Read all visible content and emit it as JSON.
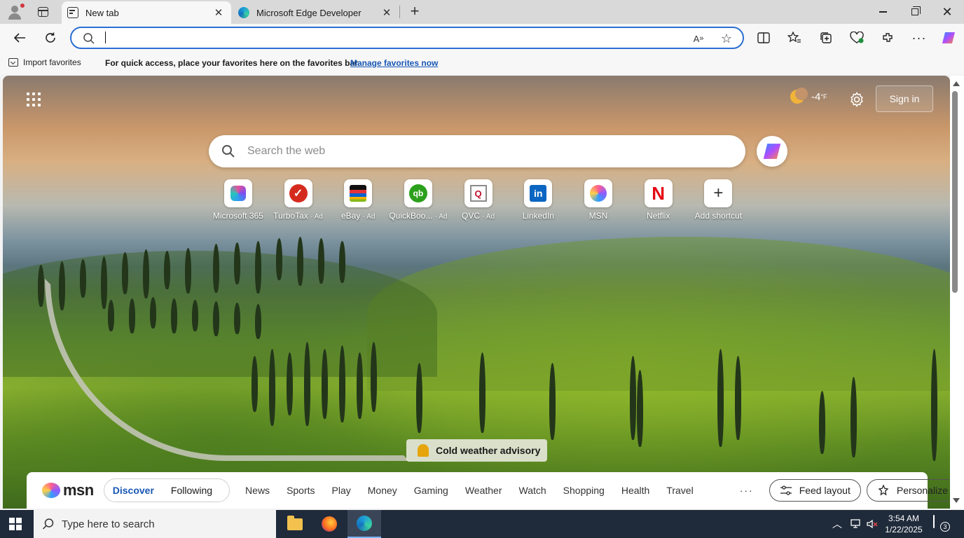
{
  "tabs": [
    {
      "title": "New tab",
      "active": true
    },
    {
      "title": "Microsoft Edge Developer",
      "active": false
    }
  ],
  "tab_close_glyph": "✕",
  "new_tab_glyph": "+",
  "window_close_glyph": "✕",
  "address_bar": {
    "value": "",
    "placeholder": ""
  },
  "favorites_bar": {
    "import_label": "Import favorites",
    "message": "For quick access, place your favorites here on the favorites bar.",
    "link": "Manage favorites now"
  },
  "new_tab_page": {
    "weather": {
      "temperature": "-4",
      "unit": "°F"
    },
    "sign_in": "Sign in",
    "search_placeholder": "Search the web",
    "shortcuts": [
      {
        "label": "Microsoft 365",
        "ad": "",
        "icon": "microsoft-365-icon"
      },
      {
        "label": "TurboTax",
        "ad": "· Ad",
        "icon": "turbotax-icon"
      },
      {
        "label": "eBay",
        "ad": "· Ad",
        "icon": "ebay-icon"
      },
      {
        "label": "QuickBoo...",
        "ad": "· Ad",
        "icon": "quickbooks-icon"
      },
      {
        "label": "QVC",
        "ad": "· Ad",
        "icon": "qvc-icon"
      },
      {
        "label": "LinkedIn",
        "ad": "",
        "icon": "linkedin-icon"
      },
      {
        "label": "MSN",
        "ad": "",
        "icon": "msn-icon"
      },
      {
        "label": "Netflix",
        "ad": "",
        "icon": "netflix-icon"
      },
      {
        "label": "Add shortcut",
        "ad": "",
        "icon": "add-icon"
      }
    ],
    "shortcut_glyphs": {
      "turbotax": "✓",
      "quickbooks": "qb",
      "qvc": "Q",
      "linkedin": "in",
      "netflix": "N",
      "add": "+"
    },
    "advisory": "Cold weather advisory",
    "msn": {
      "logo": "msn",
      "tabs": [
        "Discover",
        "Following"
      ],
      "nav": [
        "News",
        "Sports",
        "Play",
        "Money",
        "Gaming",
        "Weather",
        "Watch",
        "Shopping",
        "Health",
        "Travel"
      ],
      "more": "···",
      "feed_layout": "Feed layout",
      "personalize": "Personalize"
    }
  },
  "taskbar": {
    "search_placeholder": "Type here to search",
    "time": "3:54 AM",
    "date": "1/22/2025",
    "notifications": "3",
    "tray_chevron": "︿"
  },
  "colors": {
    "accent": "#2a6ed3",
    "link": "#1857b5",
    "taskbar": "#1f2a3a"
  }
}
